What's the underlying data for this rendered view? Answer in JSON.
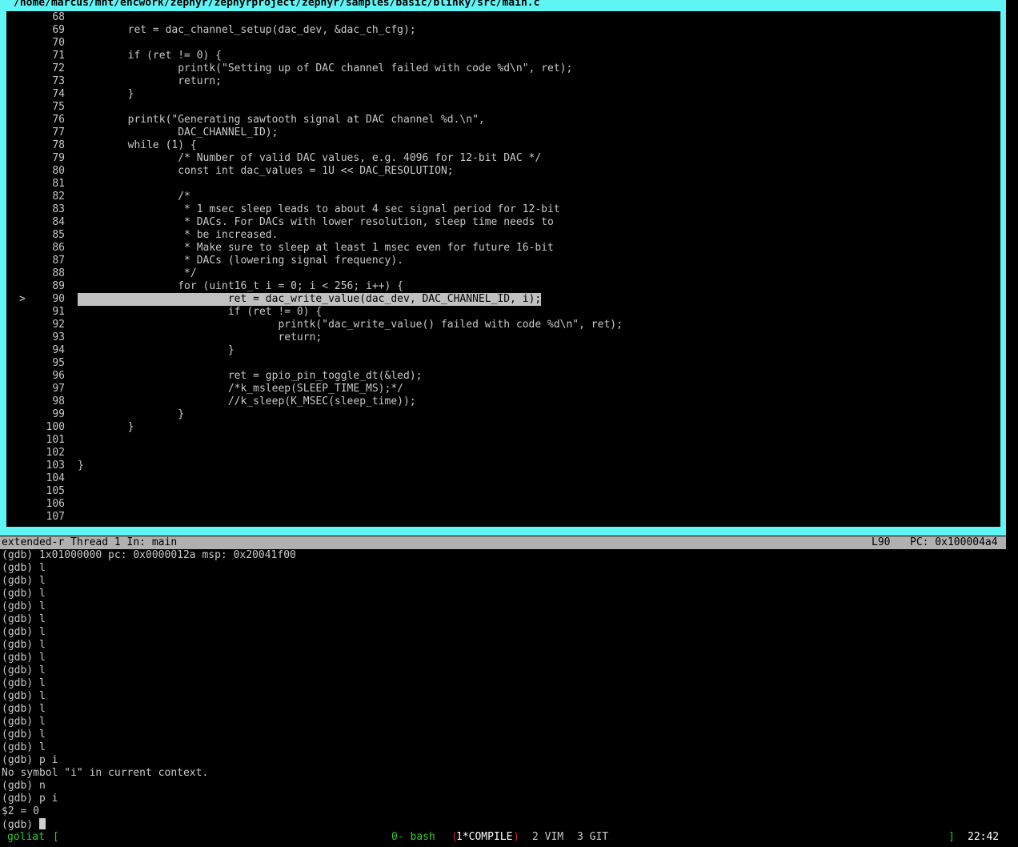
{
  "source": {
    "file_path": "/home/marcus/mnt/encwork/zephyr/zephyrproject/zephyr/samples/basic/blinky/src/main.c",
    "lines": [
      {
        "num": "68",
        "code": "",
        "marker": "",
        "current": false
      },
      {
        "num": "69",
        "code": "        ret = dac_channel_setup(dac_dev, &dac_ch_cfg);",
        "marker": "",
        "current": false
      },
      {
        "num": "70",
        "code": "",
        "marker": "",
        "current": false
      },
      {
        "num": "71",
        "code": "        if (ret != 0) {",
        "marker": "",
        "current": false
      },
      {
        "num": "72",
        "code": "                printk(\"Setting up of DAC channel failed with code %d\\n\", ret);",
        "marker": "",
        "current": false
      },
      {
        "num": "73",
        "code": "                return;",
        "marker": "",
        "current": false
      },
      {
        "num": "74",
        "code": "        }",
        "marker": "",
        "current": false
      },
      {
        "num": "75",
        "code": "",
        "marker": "",
        "current": false
      },
      {
        "num": "76",
        "code": "        printk(\"Generating sawtooth signal at DAC channel %d.\\n\",",
        "marker": "",
        "current": false
      },
      {
        "num": "77",
        "code": "                DAC_CHANNEL_ID);",
        "marker": "",
        "current": false
      },
      {
        "num": "78",
        "code": "        while (1) {",
        "marker": "",
        "current": false
      },
      {
        "num": "79",
        "code": "                /* Number of valid DAC values, e.g. 4096 for 12-bit DAC */",
        "marker": "",
        "current": false
      },
      {
        "num": "80",
        "code": "                const int dac_values = 1U << DAC_RESOLUTION;",
        "marker": "",
        "current": false
      },
      {
        "num": "81",
        "code": "",
        "marker": "",
        "current": false
      },
      {
        "num": "82",
        "code": "                /*",
        "marker": "",
        "current": false
      },
      {
        "num": "83",
        "code": "                 * 1 msec sleep leads to about 4 sec signal period for 12-bit",
        "marker": "",
        "current": false
      },
      {
        "num": "84",
        "code": "                 * DACs. For DACs with lower resolution, sleep time needs to",
        "marker": "",
        "current": false
      },
      {
        "num": "85",
        "code": "                 * be increased.",
        "marker": "",
        "current": false
      },
      {
        "num": "86",
        "code": "                 * Make sure to sleep at least 1 msec even for future 16-bit",
        "marker": "",
        "current": false
      },
      {
        "num": "87",
        "code": "                 * DACs (lowering signal frequency).",
        "marker": "",
        "current": false
      },
      {
        "num": "88",
        "code": "                 */",
        "marker": "",
        "current": false
      },
      {
        "num": "89",
        "code": "                for (uint16_t i = 0; i < 256; i++) {",
        "marker": "",
        "current": false
      },
      {
        "num": "90",
        "code": "                        ret = dac_write_value(dac_dev, DAC_CHANNEL_ID, i);",
        "marker": ">",
        "current": true
      },
      {
        "num": "91",
        "code": "                        if (ret != 0) {",
        "marker": "",
        "current": false
      },
      {
        "num": "92",
        "code": "                                printk(\"dac_write_value() failed with code %d\\n\", ret);",
        "marker": "",
        "current": false
      },
      {
        "num": "93",
        "code": "                                return;",
        "marker": "",
        "current": false
      },
      {
        "num": "94",
        "code": "                        }",
        "marker": "",
        "current": false
      },
      {
        "num": "95",
        "code": "",
        "marker": "",
        "current": false
      },
      {
        "num": "96",
        "code": "                        ret = gpio_pin_toggle_dt(&led);",
        "marker": "",
        "current": false
      },
      {
        "num": "97",
        "code": "                        /*k_msleep(SLEEP_TIME_MS);*/",
        "marker": "",
        "current": false
      },
      {
        "num": "98",
        "code": "                        //k_sleep(K_MSEC(sleep_time));",
        "marker": "",
        "current": false
      },
      {
        "num": "99",
        "code": "                }",
        "marker": "",
        "current": false
      },
      {
        "num": "100",
        "code": "        }",
        "marker": "",
        "current": false
      },
      {
        "num": "101",
        "code": "",
        "marker": "",
        "current": false
      },
      {
        "num": "102",
        "code": "",
        "marker": "",
        "current": false
      },
      {
        "num": "103",
        "code": "}",
        "marker": "",
        "current": false
      },
      {
        "num": "104",
        "code": "",
        "marker": "",
        "current": false
      },
      {
        "num": "105",
        "code": "",
        "marker": "",
        "current": false
      },
      {
        "num": "106",
        "code": "",
        "marker": "",
        "current": false
      },
      {
        "num": "107",
        "code": "",
        "marker": "",
        "current": false
      }
    ]
  },
  "status": {
    "target_info": "extended-r Thread 1 In: main",
    "line_indicator": "L90",
    "pc_indicator": "PC: 0x100004a4"
  },
  "console": {
    "lines": [
      "(gdb) 1x01000000 pc: 0x0000012a msp: 0x20041f00",
      "(gdb) l",
      "(gdb) l",
      "(gdb) l",
      "(gdb) l",
      "(gdb) l",
      "(gdb) l",
      "(gdb) l",
      "(gdb) l",
      "(gdb) l",
      "(gdb) l",
      "(gdb) l",
      "(gdb) l",
      "(gdb) l",
      "(gdb) l",
      "(gdb) l",
      "(gdb) p i",
      "No symbol \"i\" in current context.",
      "(gdb) n",
      "(gdb) p i",
      "$2 = 0"
    ],
    "prompt": "(gdb) "
  },
  "tmux": {
    "host": "goliat",
    "left_bracket": "[",
    "windows": [
      {
        "label": "0- bash",
        "active": false
      },
      {
        "label": "1*COMPILE",
        "active": true
      },
      {
        "label": "2 VIM",
        "active": false
      },
      {
        "label": "3 GIT",
        "active": false
      }
    ],
    "active_open": "(",
    "active_close": ")",
    "right_bracket": "]",
    "time": "22:42"
  }
}
